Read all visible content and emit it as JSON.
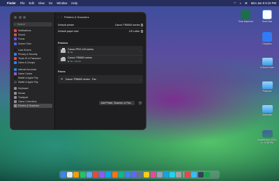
{
  "menubar": {
    "app": "Finder",
    "items": [
      "File",
      "Edit",
      "View",
      "Go",
      "Window",
      "Help"
    ],
    "clock": "Mon Jan 8  6:10 PM"
  },
  "window": {
    "title": "Printers & Scanners",
    "search_placeholder": "Search",
    "sidebar": [
      {
        "label": "Notifications",
        "color": "#e5484d"
      },
      {
        "label": "Sound",
        "color": "#e5484d"
      },
      {
        "label": "Focus",
        "color": "#5e5ce6"
      },
      {
        "label": "Screen Time",
        "color": "#5e5ce6"
      },
      {
        "label": "",
        "color": ""
      },
      {
        "label": "Lock Screen",
        "color": "#1c1c1e"
      },
      {
        "label": "Privacy & Security",
        "color": "#2f7cf6"
      },
      {
        "label": "Touch ID & Password",
        "color": "#e5484d"
      },
      {
        "label": "Users & Groups",
        "color": "#2f7cf6"
      },
      {
        "label": "",
        "color": ""
      },
      {
        "label": "Internet Accounts",
        "color": "#2f7cf6"
      },
      {
        "label": "Game Center",
        "color": "#9b59b6"
      },
      {
        "label": "Wallet & Apple Pay",
        "color": "#1c1c1e"
      },
      {
        "label": "Wallet & Apple Pay",
        "color": "#444"
      },
      {
        "label": "",
        "color": ""
      },
      {
        "label": "Keyboard",
        "color": "#8e8e93"
      },
      {
        "label": "Mouse",
        "color": "#8e8e93"
      },
      {
        "label": "Trackpad",
        "color": "#8e8e93"
      },
      {
        "label": "Game Controllers",
        "color": "#8e8e93"
      },
      {
        "label": "Printers & Scanners",
        "color": "#8e8e93",
        "selected": true
      }
    ],
    "default_printer_label": "Default printer",
    "default_printer_value": "Canon TR8600 series",
    "paper_size_label": "Default paper size",
    "paper_size_value": "US Letter",
    "printers_heading": "Printers",
    "printers": [
      {
        "name": "Canon PRO-100 series",
        "status": "Idle",
        "dot": "#8e8e93"
      },
      {
        "name": "Canon TR8600 series",
        "status": "Idle, Default",
        "dot": "#30d158"
      }
    ],
    "faxes_heading": "Faxes",
    "faxes": [
      {
        "name": "Canon TR8600 series - Fax"
      }
    ],
    "add_button": "Add Printer, Scanner, or Fax...",
    "help": "?"
  },
  "desktop": [
    {
      "label": "Time Machine",
      "kind": "time"
    },
    {
      "label": "OneDrive",
      "kind": "onedrive"
    },
    {
      "label": "Dropbox",
      "kind": "dropbox"
    },
    {
      "label": "iCloud Drive",
      "kind": "folder"
    },
    {
      "label": "Pictures",
      "kind": "folder"
    },
    {
      "label": "Manuals",
      "kind": "folder"
    },
    {
      "label": "Screenshot 2024-0...5.48 PM",
      "kind": "shot"
    }
  ],
  "dock_colors": [
    "#3b82f6",
    "#e5e7eb",
    "#f59e0b",
    "#22c55e",
    "#60a5fa",
    "#ef4444",
    "#8b5cf6",
    "#0ea5e9",
    "#f97316",
    "#10b981",
    "#3b82f6",
    "#6366f1",
    "#64748b",
    "#facc15",
    "#ec4899",
    "#94a3b8",
    "#0ea5e9",
    "#22d3ee",
    "#a3a3a3",
    "#ef4444",
    "#38bdf8",
    "#334155",
    "#16a34a"
  ]
}
